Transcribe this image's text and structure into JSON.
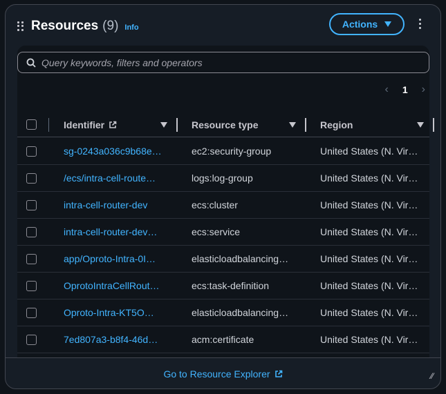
{
  "header": {
    "title": "Resources",
    "count": "(9)",
    "info": "Info",
    "actions_label": "Actions"
  },
  "search": {
    "placeholder": "Query keywords, filters and operators"
  },
  "pagination": {
    "current": "1"
  },
  "columns": [
    "Identifier",
    "Resource type",
    "Region"
  ],
  "rows": [
    {
      "identifier": "sg-0243a036c9b68e…",
      "type": "ec2:security-group",
      "region": "United States (N. Vir…"
    },
    {
      "identifier": "/ecs/intra-cell-route…",
      "type": "logs:log-group",
      "region": "United States (N. Vir…"
    },
    {
      "identifier": "intra-cell-router-dev",
      "type": "ecs:cluster",
      "region": "United States (N. Vir…"
    },
    {
      "identifier": "intra-cell-router-dev…",
      "type": "ecs:service",
      "region": "United States (N. Vir…"
    },
    {
      "identifier": "app/Oproto-Intra-0I…",
      "type": "elasticloadbalancing…",
      "region": "United States (N. Vir…"
    },
    {
      "identifier": "OprotoIntraCellRout…",
      "type": "ecs:task-definition",
      "region": "United States (N. Vir…"
    },
    {
      "identifier": "Oproto-Intra-KT5O…",
      "type": "elasticloadbalancing…",
      "region": "United States (N. Vir…"
    },
    {
      "identifier": "7ed807a3-b8f4-46d…",
      "type": "acm:certificate",
      "region": "United States (N. Vir…"
    }
  ],
  "footer": {
    "link": "Go to Resource Explorer"
  }
}
